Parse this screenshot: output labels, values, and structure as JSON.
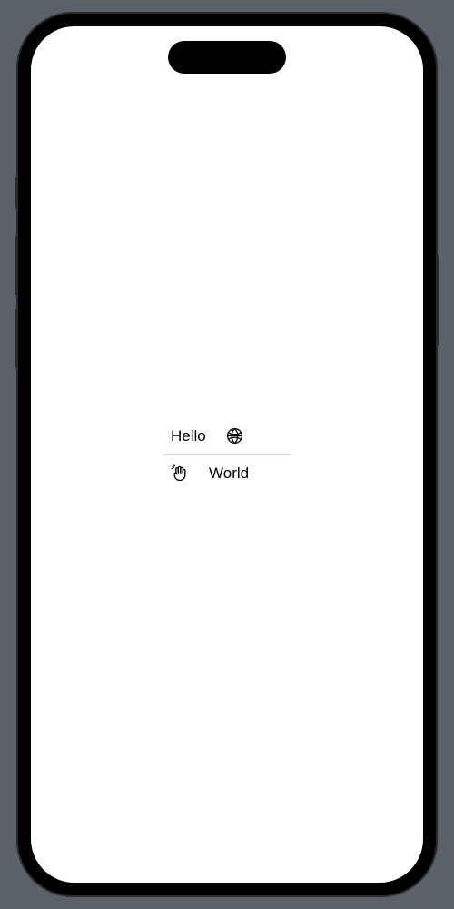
{
  "rows": [
    {
      "label": "Hello",
      "icon": "globe"
    },
    {
      "label": "World",
      "icon": "hand-wave"
    }
  ]
}
